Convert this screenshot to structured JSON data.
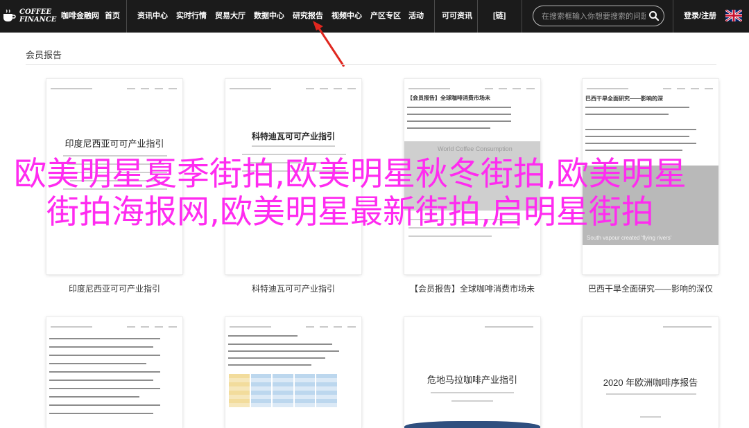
{
  "brand": {
    "line1": "COFFEE",
    "line2": "FINANCE"
  },
  "nav": {
    "items": [
      "咖啡金融网",
      "首页",
      "资讯中心",
      "实时行情",
      "贸易大厅",
      "数据中心",
      "研究报告",
      "视频中心",
      "产区专区",
      "活动",
      "可可资讯",
      "[链]"
    ],
    "active_index": 6,
    "search_placeholder": "在搜索框输入你想要搜索的问题",
    "search_icon": "search-icon",
    "login": "登录/注册",
    "flag_icon": "uk-flag-icon"
  },
  "section": {
    "title": "会员报告"
  },
  "cards_row1": [
    {
      "doc_title": "印度尼西亚可可产业指引",
      "caption": "印度尼西亚可可产业指引"
    },
    {
      "doc_title": "科特迪瓦可可产业指引",
      "caption": "科特迪瓦可可产业指引"
    },
    {
      "badge": "【会员报告】全球咖啡消费市场未",
      "banner": "World Coffee Consumption",
      "caption": "【会员报告】全球咖啡消费市场未"
    },
    {
      "badge": "巴西干旱全面研究——影响的深",
      "banner": "South vapour created 'flying rivers'",
      "caption": "巴西干旱全面研究——影响的深仅"
    }
  ],
  "cards_row2": [
    {
      "doc_title": ""
    },
    {
      "doc_title": ""
    },
    {
      "doc_title": "危地马拉咖啡产业指引"
    },
    {
      "doc_title": "2020 年欧洲咖啡序报告"
    }
  ],
  "overlay_text": "欧美明星夏季街拍,欧美明星秋冬街拍,欧美明星街拍海报网,欧美明星最新街拍,启明星街拍",
  "colors": {
    "nav_bg": "#1b1b1b",
    "overlay": "#ff2bf0",
    "arrow": "#e0271f"
  }
}
